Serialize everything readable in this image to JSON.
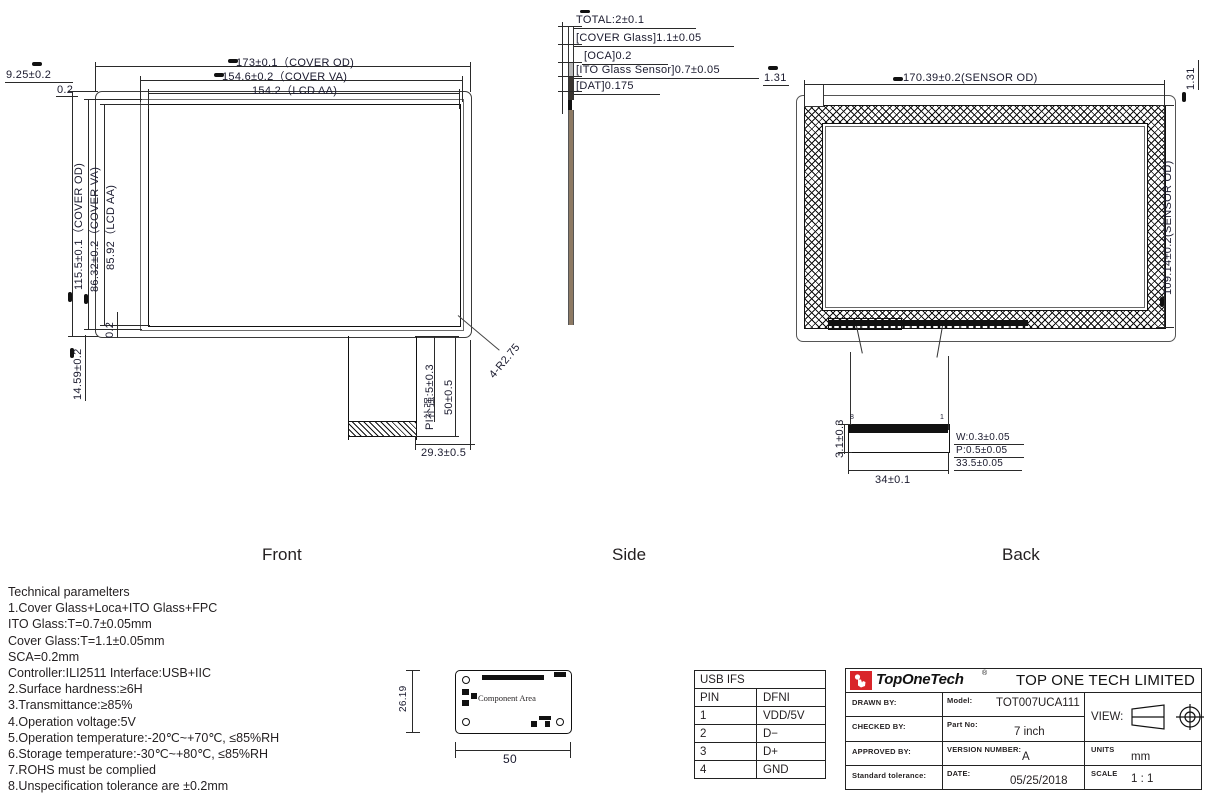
{
  "doc": {
    "views": {
      "front": "Front",
      "side": "Side",
      "back": "Back"
    }
  },
  "front_view": {
    "dims": {
      "cover_od_w": "173±0.1（COVER OD)",
      "cover_va_w": "154.6±0.2（COVER VA)",
      "lcd_aa_w": "154.2（LCD AA)",
      "left_offset": "9.25±0.2",
      "left_small": "0.2",
      "cover_od_h": "115.5±0.1（COVER OD)",
      "cover_va_h": "86.32±0.2（COVER VA)",
      "lcd_aa_h": "85.92（LCD AA)",
      "bottom_small": "0.2",
      "bottom_offset": "14.59±0.2",
      "pi_label": "PI补强:5±0.3",
      "fpc_len": "50±0.5",
      "fpc_pos": "29.3±0.5",
      "corner_r": "4-R2.75"
    }
  },
  "side_view": {
    "stack": [
      {
        "name": "TOTAL:2±0.1"
      },
      {
        "name": "[COVER Glass]1.1±0.05"
      },
      {
        "name": "[OCA]0.2"
      },
      {
        "name": "[ITO Glass Sensor]0.7±0.05"
      },
      {
        "name": "[DAT]0.175"
      }
    ]
  },
  "back_view": {
    "dims": {
      "sensor_od_w": "170.39±0.2(SENSOR OD)",
      "sensor_od_h": "109.14±0.2(SENSOR OD)",
      "edge_left": "1.31",
      "edge_right": "1.31",
      "fpc_h": "3.1±0.3",
      "fpc_w": "34±0.1",
      "trace_w": "W:0.3±0.05",
      "trace_p": "P:0.5±0.05",
      "trace_total": "33.5±0.05",
      "pin_first": "8",
      "pin_last": "1"
    }
  },
  "component_view": {
    "label": "Component Area",
    "height": "26.19",
    "width": "50"
  },
  "tech": {
    "title": "Technical paramelters",
    "lines": [
      "1.Cover Glass+Loca+ITO Glass+FPC",
      "   ITO Glass:T=0.7±0.05mm",
      "   Cover Glass:T=1.1±0.05mm",
      "   SCA=0.2mm",
      "   Controller:ILI2511    Interface:USB+IIC",
      "2.Surface hardness:≥6H",
      "3.Transmittance:≥85%",
      "4.Operation voltage:5V",
      "5.Operation temperature:-20℃~+70℃,  ≤85%RH",
      "6.Storage temperature:-30℃~+80℃,  ≤85%RH",
      "7.ROHS must be complied",
      "8.Unspecification tolerance are ±0.2mm"
    ]
  },
  "pin_table": {
    "title": "USB IFS",
    "headers": [
      "PIN",
      "DFNI"
    ],
    "rows": [
      [
        "1",
        "VDD/5V"
      ],
      [
        "2",
        "D−"
      ],
      [
        "3",
        "D+"
      ],
      [
        "4",
        "GND"
      ]
    ]
  },
  "title_block": {
    "logo_text": "TopOneTech",
    "logo_reg": "®",
    "company": "TOP ONE TECH LIMITED",
    "logo_color": "#d9252a",
    "rows": [
      {
        "label": "DRAWN BY:",
        "value": ""
      },
      {
        "label": "CHECKED BY:",
        "value": ""
      },
      {
        "label": "APPROVED BY:",
        "value": ""
      },
      {
        "label": "Standard tolerance:",
        "value": ""
      }
    ],
    "mid": [
      {
        "label": "Model:",
        "value": "TOT007UCA111"
      },
      {
        "label": "Part No:",
        "value": "7 inch"
      },
      {
        "label": "VERSION NUMBER:",
        "value": "A"
      },
      {
        "label": "DATE:",
        "value": "05/25/2018"
      }
    ],
    "right": [
      {
        "label": "VIEW:",
        "value": ""
      },
      {
        "label": "UNITS",
        "value": "mm"
      },
      {
        "label": "SCALE",
        "value": "1 : 1"
      }
    ]
  }
}
